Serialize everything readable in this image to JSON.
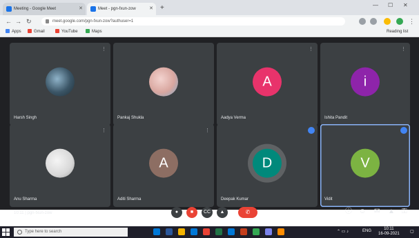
{
  "browser": {
    "tabs": [
      {
        "title": "Meeting - Google Meet",
        "active": false
      },
      {
        "title": "Meet - pgn-fxun-zow",
        "active": true
      }
    ],
    "new_tab_symbol": "+",
    "address": "meet.google.com/pgn-fxun-zow?authuser=1",
    "bookmarks": [
      {
        "label": "Apps",
        "color": "#4285f4"
      },
      {
        "label": "Gmail",
        "color": "#ea4335"
      },
      {
        "label": "YouTube",
        "color": "#ea4335"
      },
      {
        "label": "Maps",
        "color": "#34a853"
      }
    ],
    "reading_list": "Reading list"
  },
  "meeting": {
    "participants": [
      {
        "name": "Harsh Singh",
        "initial": "",
        "avatar_color": "#5f7c8f",
        "kind": "photo"
      },
      {
        "name": "Pankaj Shukla",
        "initial": "",
        "avatar_color": "#d9a7a0",
        "kind": "photo"
      },
      {
        "name": "Aadya Verma",
        "initial": "A",
        "avatar_color": "#e8336b",
        "kind": "letter"
      },
      {
        "name": "Ishita Pandit",
        "initial": "i",
        "avatar_color": "#8e24aa",
        "kind": "letter"
      },
      {
        "name": "Anu Sharma",
        "initial": "",
        "avatar_color": "#d8d8d8",
        "kind": "photo"
      },
      {
        "name": "Aditi Sharma",
        "initial": "A",
        "avatar_color": "#8d6e63",
        "kind": "letter"
      },
      {
        "name": "Deepak Kumar",
        "initial": "D",
        "avatar_color": "#00897b",
        "kind": "letter",
        "speaking": true
      },
      {
        "name": "Vidit",
        "initial": "V",
        "avatar_color": "#7cb342",
        "kind": "letter",
        "speaking": true,
        "selected": true
      }
    ],
    "time": "10:11",
    "meeting_code": "pgn-fxun-zow",
    "controls": {
      "mic": "mic-off-icon",
      "camera": "camera-off-icon",
      "captions": "CC",
      "present": "present-icon",
      "more": "⋮",
      "end_call": "end-call-icon"
    }
  },
  "taskbar": {
    "search_placeholder": "Type here to search",
    "time": "10:11",
    "date": "16-09-2021",
    "lang": "ENG"
  },
  "colors": {
    "meet_bg": "#202124",
    "tile_bg": "#3c4043",
    "end_call": "#ea4335",
    "speaking_badge": "#4285f4"
  }
}
